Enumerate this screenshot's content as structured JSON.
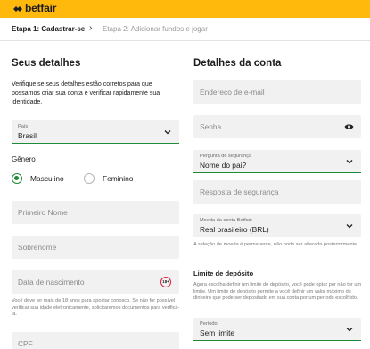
{
  "brand": {
    "name": "betfair",
    "bar_color": "#ffb80c",
    "accent": "#1e8a3a"
  },
  "steps": {
    "current": "Etapa 1: Cadastrar-se",
    "next": "Etapa 2: Adicionar fundos e jogar",
    "separator_icon": "chevron-right-icon"
  },
  "left": {
    "title": "Seus detalhes",
    "intro": "Verifique se seus detalhes estão corretos para que possamos criar sua conta e verificar rapidamente sua identidade.",
    "country": {
      "label": "País",
      "value": "Brasil"
    },
    "gender": {
      "label": "Gênero",
      "options": [
        "Masculino",
        "Feminino"
      ],
      "selected": "Masculino"
    },
    "first_name": {
      "placeholder": "Primeiro Nome"
    },
    "last_name": {
      "placeholder": "Sobrenome"
    },
    "dob": {
      "placeholder": "Data de nascimento",
      "badge": "18+"
    },
    "dob_note": "Você deve ter mais de 18 anos para apostar conosco. Se não for possível verificar sua idade eletronicamente, solicitaremos documentos para verificá-la.",
    "cpf": {
      "placeholder": "CPF"
    }
  },
  "right": {
    "title": "Detalhes da conta",
    "email": {
      "placeholder": "Endereço de e-mail"
    },
    "password": {
      "placeholder": "Senha",
      "icon": "eye-icon"
    },
    "security_question": {
      "label": "Pergunta de segurança",
      "value": "Nome do pai?"
    },
    "security_answer": {
      "placeholder": "Resposta de segurança"
    },
    "currency": {
      "label": "Moeda da conta Betfair:",
      "value": "Real brasileiro (BRL)"
    },
    "currency_note": "A seleção de moeda é permanente, não pode ser alterada posteriormente.",
    "deposit_limit": {
      "title": "Limite de depósito",
      "text": "Agora escolha definir um limite de depósito, você pode optar por não ter um limite. Um limite de depósito permite a você definir um valor máximo de dinheiro que pode ser depositado em sua conta por um período escolhido.",
      "period": {
        "label": "Período",
        "value": "Sem limite"
      }
    }
  }
}
